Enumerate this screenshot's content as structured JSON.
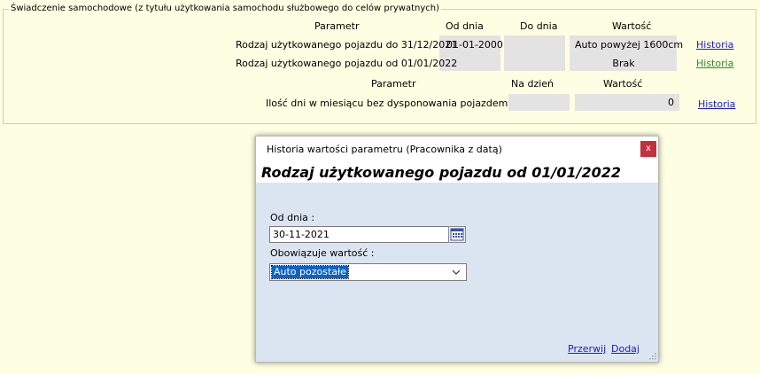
{
  "section": {
    "legend": "Świadczenie samochodowe (z tytułu użytkowania samochodu służbowego do celów prywatnych)",
    "headers1": {
      "parametr": "Parametr",
      "od_dnia": "Od dnia",
      "do_dnia": "Do dnia",
      "wartosc": "Wartość"
    },
    "rows1": [
      {
        "label": "Rodzaj użytkowanego pojazdu do 31/12/2021",
        "od": "01-01-2000",
        "do": "",
        "wartosc": "Auto powyżej 1600cm",
        "link": "Historia"
      },
      {
        "label": "Rodzaj użytkowanego pojazdu od 01/01/2022",
        "od": "",
        "do": "",
        "wartosc": "Brak",
        "link": "Historia"
      }
    ],
    "headers2": {
      "parametr": "Parametr",
      "na_dzien": "Na dzień",
      "wartosc": "Wartość"
    },
    "rows2": [
      {
        "label": "Ilość dni w miesiącu bez dysponowania pojazdem",
        "na_dzien": "",
        "wartosc": "0",
        "link": "Historia"
      }
    ]
  },
  "dialog": {
    "title": "Historia wartości parametru (Pracownika z datą)",
    "close": "x",
    "heading": "Rodzaj użytkowanego pojazdu od 01/01/2022",
    "od_dnia_label": "Od dnia :",
    "od_dnia_value": "30-11-2021",
    "obowiazuje_label": "Obowiązuje wartość  :",
    "obowiazuje_value": "Auto pozostałe",
    "cancel": "Przerwij",
    "add": "Dodaj"
  },
  "colors": {
    "background": "#fefee2",
    "dialog_bg": "#dbe5f1",
    "link": "#1a1acc",
    "link_active": "#2e8b2e",
    "close_btn": "#c4313d",
    "selection": "#0a63c9"
  }
}
